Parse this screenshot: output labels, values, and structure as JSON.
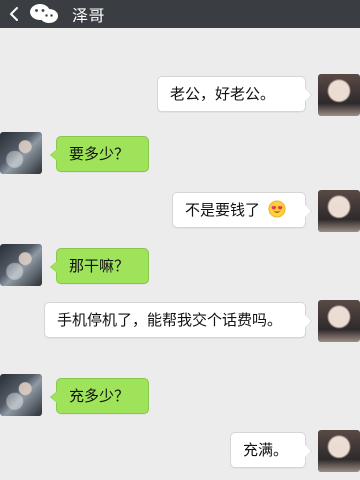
{
  "header": {
    "back_icon": "chevron-left-icon",
    "wechat_icon": "wechat-icon",
    "title": "泽哥"
  },
  "messages": [
    {
      "side": "right",
      "style": "white",
      "text": "老公，好老公。"
    },
    {
      "side": "left",
      "style": "green",
      "text": "要多少？"
    },
    {
      "side": "right",
      "style": "white",
      "text": "不是要钱了",
      "emoji": "heart-eyes-emoji"
    },
    {
      "side": "left",
      "style": "green",
      "text": "那干嘛？"
    },
    {
      "side": "right",
      "style": "white",
      "text": "手机停机了，能帮我交个话费吗。"
    },
    {
      "side": "left",
      "style": "green",
      "text": "充多少？"
    },
    {
      "side": "right",
      "style": "white",
      "text": "充满。"
    }
  ],
  "colors": {
    "header_bg": "#3a3d42",
    "chat_bg": "#ececec",
    "incoming_bubble": "#9fe35a",
    "outgoing_bubble": "#ffffff"
  }
}
